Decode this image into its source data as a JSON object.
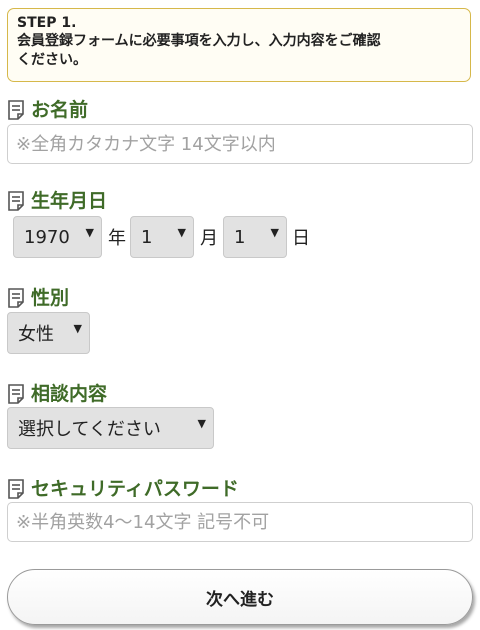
{
  "step": {
    "title": "STEP 1.",
    "line1": "会員登録フォームに必要事項を入力し、入力内容をご確認",
    "line2": "ください。"
  },
  "form": {
    "name": {
      "label": "お名前",
      "placeholder": "※全角カタカナ文字 14文字以内"
    },
    "birthdate": {
      "label": "生年月日",
      "year_value": "1970",
      "year_unit": "年",
      "month_value": "1",
      "month_unit": "月",
      "day_value": "1",
      "day_unit": "日"
    },
    "gender": {
      "label": "性別",
      "value": "女性"
    },
    "consultation": {
      "label": "相談内容",
      "value": "選択してください"
    },
    "password": {
      "label": "セキュリティパスワード",
      "placeholder": "※半角英数4〜14文字 記号不可"
    }
  },
  "next_button": {
    "label": "次へ進む"
  },
  "icons": {
    "section": "document-icon",
    "dropdown": "triangle-down-icon"
  },
  "colors": {
    "label_green": "#3f6b28",
    "step_border": "#d6b84a",
    "select_bg": "#e2e2e2"
  }
}
